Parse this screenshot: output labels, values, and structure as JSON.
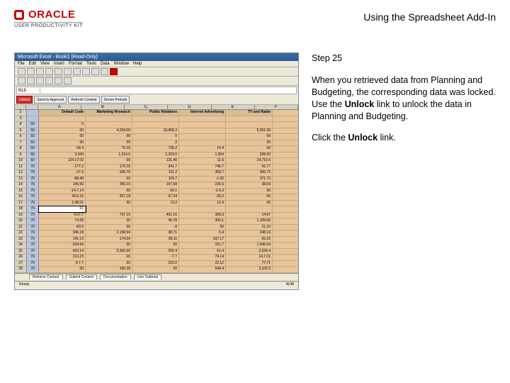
{
  "header": {
    "brand": "ORACLE",
    "product": "USER PRODUCTIVITY KIT",
    "title": "Using the Spreadsheet Add-In"
  },
  "instructions": {
    "step": "Step 25",
    "body_pre": "When you retrieved data from Planning and Budgeting, the corresponding data was locked. Use the ",
    "body_bold1": "Unlock",
    "body_mid": " link to unlock the data in Planning and Budgeting.",
    "action_pre": "Click the ",
    "action_bold": "Unlock",
    "action_post": " link."
  },
  "screenshot": {
    "titlebar": "Microsoft Excel - Book1 [Read-Only]",
    "menus": [
      "File",
      "Edit",
      "View",
      "Insert",
      "Format",
      "Tools",
      "Data",
      "Window",
      "Help"
    ],
    "namebox": "B18",
    "context_buttons": [
      "Unlock",
      "Send to Approval",
      "Refresh Context",
      "Derive Periods"
    ],
    "col_labels": [
      "A",
      "B",
      "C",
      "D",
      "E",
      "F"
    ],
    "worksheet_header": [
      "",
      "Default Code",
      "Marketing Research",
      "Public Relations",
      "Internet Advertising",
      "TV and Radio"
    ],
    "rows": [
      {
        "n": "3",
        "code": "",
        "a": "",
        "b": "",
        "c": "",
        "d": "",
        "e": ""
      },
      {
        "n": "4",
        "code": "50",
        "a": "0",
        "b": "",
        "c": "",
        "d": "",
        "e": ""
      },
      {
        "n": "5",
        "code": "50",
        "a": "00",
        "b": "4,234.00",
        "c": "18,965.3",
        "d": "",
        "e": "5,061.00"
      },
      {
        "n": "6",
        "code": "50",
        "a": "00",
        "b": "00",
        "c": "0",
        "d": "",
        "e": "00"
      },
      {
        "n": "7",
        "code": "50",
        "a": "00",
        "b": "00",
        "c": "2",
        "d": "",
        "e": "00"
      },
      {
        "n": "8",
        "code": "50",
        "a": "54.4",
        "b": "76.16",
        "c": "738.2",
        "d": "14.4",
        "e": "00"
      },
      {
        "n": "9",
        "code": "50",
        "a": "3,349",
        "b": "1,214.0",
        "c": "1,203.0",
        "d": "1,654",
        "e": "528.00"
      },
      {
        "n": "10",
        "code": "50",
        "a": "124.17.02",
        "b": "00",
        "c": "131.40",
        "d": "11.6",
        "e": "14,710.6"
      },
      {
        "n": "11",
        "code": "70",
        "a": "-177.2",
        "b": "170.15",
        "c": "341.7",
        "d": "746.7",
        "e": "41.77"
      },
      {
        "n": "12",
        "code": "70",
        "a": "-27.3",
        "b": "336.75",
        "c": "311.2",
        "d": "358.7",
        "e": "306.73"
      },
      {
        "n": "13",
        "code": "70",
        "a": "-88.48",
        "b": "00",
        "c": "119.7",
        "d": "-1.50",
        "e": "371.73"
      },
      {
        "n": "14",
        "code": "70",
        "a": "145.90",
        "b": "350.15",
        "c": "197.58",
        "d": "236.6",
        "e": "38.09"
      },
      {
        "n": "15",
        "code": "70",
        "a": "-14.7.14",
        "b": "00",
        "c": "69.1",
        "d": "-2.4.3",
        "e": "00"
      },
      {
        "n": "16",
        "code": "70",
        "a": "24.5.15",
        "b": "357.18",
        "c": "07.34",
        "d": "83.2",
        "e": "00"
      },
      {
        "n": "17",
        "code": "70",
        "a": "1.48.01",
        "b": "00",
        "c": "73.2",
        "d": "12.4",
        "e": "00"
      },
      {
        "n": "18",
        "code": "70",
        "a": "01",
        "b": "",
        "c": "",
        "d": "",
        "e": ""
      },
      {
        "n": "19",
        "code": "70",
        "a": "4.07.7",
        "b": "737.15",
        "c": "491.16",
        "d": "308.3",
        "e": "14.87"
      },
      {
        "n": "20",
        "code": "70",
        "a": "74.29",
        "b": "00",
        "c": "45.78",
        "d": "350.1",
        "e": "1,109.66"
      },
      {
        "n": "21",
        "code": "70",
        "a": "-69.5",
        "b": "00",
        "c": "-.8",
        "d": "55",
        "e": "21.10"
      },
      {
        "n": "22",
        "code": "70",
        "a": "346.18",
        "b": "2,158.94",
        "c": "38.71",
        "d": "5.4",
        "e": "248.10"
      },
      {
        "n": "23",
        "code": "70",
        "a": "141.13",
        "b": "174.04",
        "c": "99.11",
        "d": "337.17",
        "e": "92.22"
      },
      {
        "n": "24",
        "code": "70",
        "a": "-234.94",
        "b": "00",
        "c": "00",
        "d": "151.7",
        "e": "1,646.04"
      },
      {
        "n": "25",
        "code": "70",
        "a": "410.14",
        "b": "5,566.66",
        "c": "256.4",
        "d": "61.4",
        "e": "2,529.4"
      },
      {
        "n": "26",
        "code": "70",
        "a": "213.23",
        "b": "00",
        "c": "-7.7",
        "d": "74.14",
        "e": "14.7.01"
      },
      {
        "n": "27",
        "code": "70",
        "a": "8.7.7",
        "b": "00",
        "c": "310.0",
        "d": "22.12",
        "e": "77.71"
      },
      {
        "n": "28",
        "code": "70",
        "a": "00",
        "b": "190.28",
        "c": "00",
        "d": "549.4",
        "e": "3.105.5"
      }
    ],
    "sheet_tabs": [
      "Retrieve Content",
      "Submit Content",
      "Documentation",
      "Line Subtotal"
    ],
    "status_left": "Ready",
    "status_right": "NUM"
  }
}
